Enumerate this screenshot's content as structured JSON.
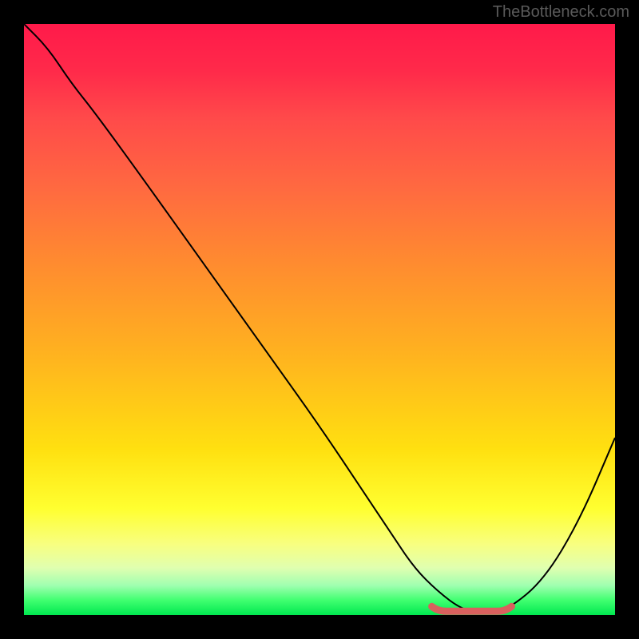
{
  "watermark": "TheBottleneck.com",
  "chart_data": {
    "type": "line",
    "title": "",
    "xlabel": "",
    "ylabel": "",
    "xlim": [
      0,
      100
    ],
    "ylim": [
      0,
      100
    ],
    "series": [
      {
        "name": "bottleneck-curve",
        "x": [
          0,
          4,
          8,
          12,
          20,
          30,
          40,
          50,
          58,
          62,
          66,
          70,
          74,
          78,
          82,
          88,
          94,
          100
        ],
        "values": [
          100,
          96,
          90,
          85,
          74,
          60,
          46,
          32,
          20,
          14,
          8,
          4,
          1,
          0,
          1,
          6,
          16,
          30
        ]
      }
    ],
    "annotations": [
      {
        "name": "flat-marker",
        "type": "segment",
        "x": [
          69,
          82.5
        ],
        "y": [
          0.5,
          0.5
        ],
        "color": "#d9605e"
      }
    ],
    "gradient_stops": [
      {
        "pos": 0,
        "color": "#ff1a4a"
      },
      {
        "pos": 0.5,
        "color": "#ffb020"
      },
      {
        "pos": 0.85,
        "color": "#ffff30"
      },
      {
        "pos": 1.0,
        "color": "#00e850"
      }
    ]
  }
}
